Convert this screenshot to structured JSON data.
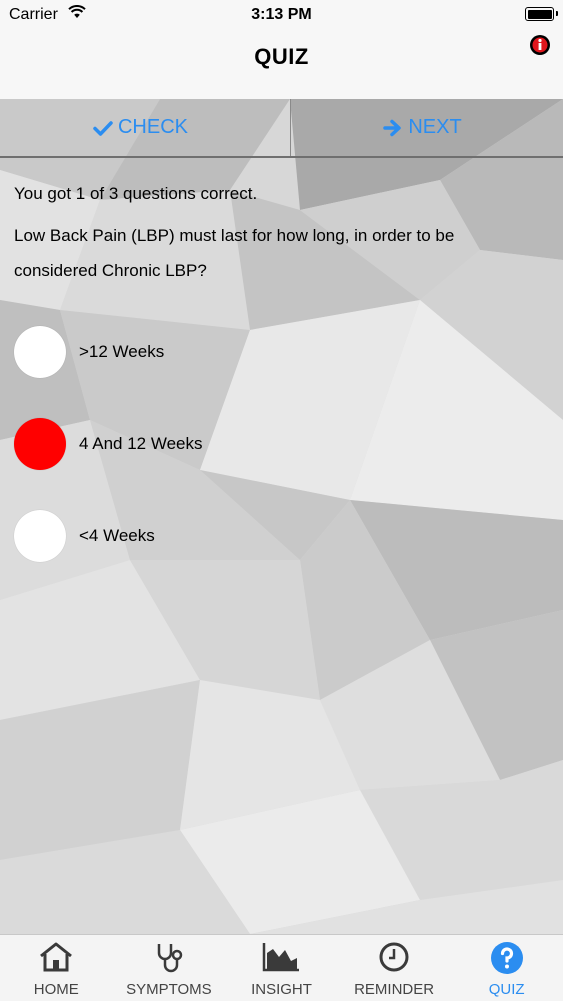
{
  "status_bar": {
    "carrier": "Carrier",
    "time": "3:13 PM"
  },
  "nav": {
    "title": "QUIZ",
    "info_icon": "info-icon"
  },
  "toolbar": {
    "check_label": "CHECK",
    "next_label": "NEXT",
    "accent": "#2b8df0"
  },
  "quiz": {
    "score_text": "You got 1 of 3 questions correct.",
    "question": "Low Back Pain (LBP) must last for how long, in order to be considered Chronic LBP?",
    "options": [
      {
        "label": ">12 Weeks",
        "selected": false
      },
      {
        "label": "4 And 12 Weeks",
        "selected": true
      },
      {
        "label": "<4 Weeks",
        "selected": false
      }
    ],
    "selected_color": "#ff0000"
  },
  "tabs": [
    {
      "label": "HOME",
      "icon": "home-icon"
    },
    {
      "label": "SYMPTOMS",
      "icon": "stethoscope-icon"
    },
    {
      "label": "INSIGHT",
      "icon": "area-chart-icon"
    },
    {
      "label": "REMINDER",
      "icon": "clock-icon"
    },
    {
      "label": "QUIZ",
      "icon": "question-icon",
      "active": true
    }
  ]
}
